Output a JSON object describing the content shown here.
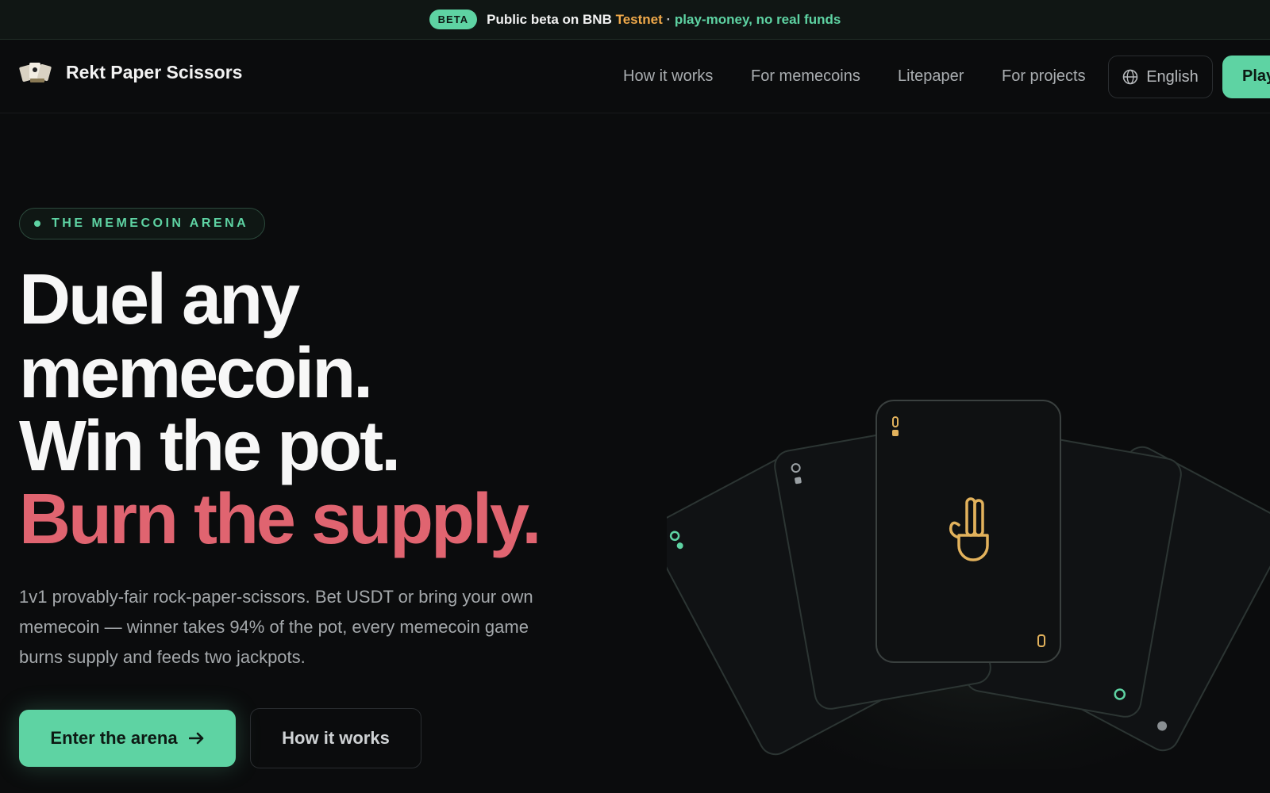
{
  "beta_bar": {
    "badge": "BETA",
    "text": "Public beta on BNB",
    "testnet": "Testnet",
    "separator": "·",
    "note": "play-money, no real funds"
  },
  "header": {
    "brand": "Rekt Paper Scissors",
    "nav": [
      "How it works",
      "For memecoins",
      "Litepaper",
      "For projects"
    ],
    "language": "English",
    "play_label": "Play"
  },
  "hero": {
    "eyebrow": "THE MEMECOIN ARENA",
    "headline": [
      "Duel any",
      "memecoin.",
      "Win the pot."
    ],
    "headline_accent": "Burn the supply.",
    "subtext": "1v1 provably-fair rock-paper-scissors. Bet USDT or bring your own memecoin — winner takes 94% of the pot, every memecoin game burns supply and feeds two jackpots.",
    "cta_primary": "Enter the arena",
    "cta_secondary": "How it works"
  },
  "colors": {
    "accent": "#5ed3a3",
    "warning": "#f0a94a",
    "headline_accent": "#e06470",
    "background": "#0b0c0d"
  },
  "icons": {
    "logo": "playing-cards-logo",
    "language": "globe-icon",
    "cta_arrow": "arrow-right-icon",
    "hero_card": "peace-hand-icon"
  }
}
